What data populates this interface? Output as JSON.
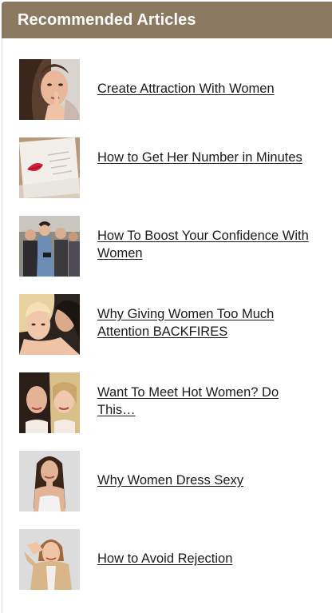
{
  "widget": {
    "title": "Recommended Articles",
    "header_color": "#8a7960",
    "link_color": "#1a1a1a"
  },
  "articles": [
    {
      "title": "Create Attraction With Women",
      "thumbnail": "woman-finger-on-lips-photo"
    },
    {
      "title": "How to Get Her Number in Minutes",
      "thumbnail": "lipstick-kiss-note-photo"
    },
    {
      "title": "How To Boost Your Confidence With Women",
      "thumbnail": "group-of-friends-photo"
    },
    {
      "title": "Why Giving Women Too Much Attention BACKFIRES",
      "thumbnail": "two-women-close-photo"
    },
    {
      "title": "Want To Meet Hot Women? Do This…",
      "thumbnail": "two-women-smiling-photo"
    },
    {
      "title": "Why Women Dress Sexy",
      "thumbnail": "woman-long-hair-photo"
    },
    {
      "title": "How to Avoid Rejection",
      "thumbnail": "woman-tan-jacket-photo"
    }
  ]
}
